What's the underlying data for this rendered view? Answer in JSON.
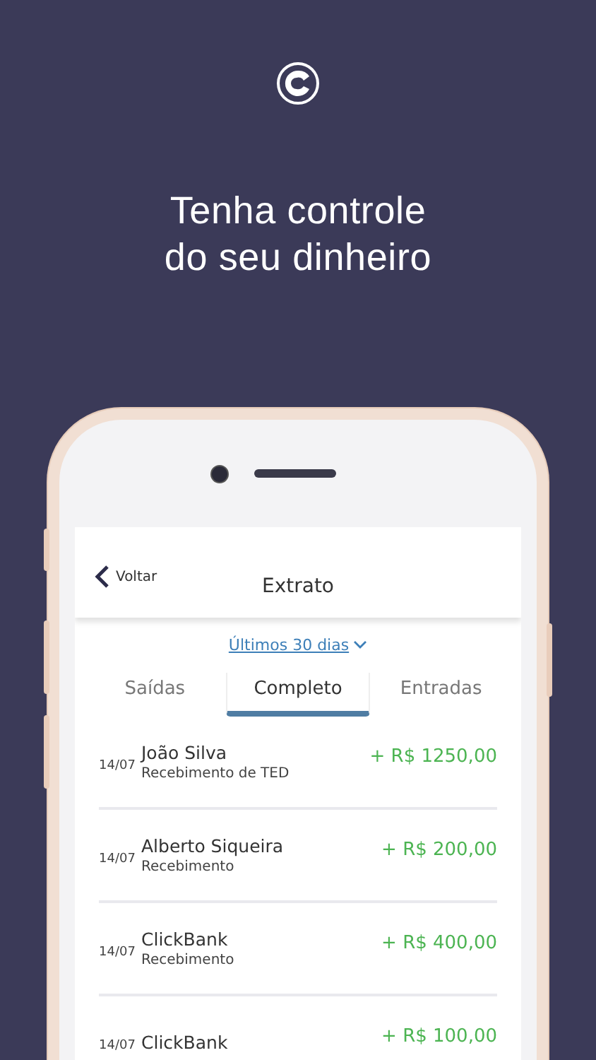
{
  "headline": [
    "Tenha controle",
    "do seu dinheiro"
  ],
  "screen": {
    "back_label": "Voltar",
    "title": "Extrato",
    "period": "Últimos 30 dias",
    "tabs": [
      {
        "label": "Saídas",
        "selected": false
      },
      {
        "label": "Completo",
        "selected": true
      },
      {
        "label": "Entradas",
        "selected": false
      }
    ],
    "transactions": [
      {
        "date": "14/07",
        "name": "João Silva",
        "description": "Recebimento de TED",
        "amount": "+ R$ 1250,00",
        "kind": "credit"
      },
      {
        "date": "14/07",
        "name": "Alberto Siqueira",
        "description": "Recebimento",
        "amount": "+ R$ 200,00",
        "kind": "credit"
      },
      {
        "date": "14/07",
        "name": "ClickBank",
        "description": "Recebimento",
        "amount": "+ R$ 400,00",
        "kind": "credit"
      },
      {
        "date": "14/07",
        "name": "ClickBank",
        "amount": "+ R$ 100,00",
        "kind": "credit"
      }
    ]
  }
}
